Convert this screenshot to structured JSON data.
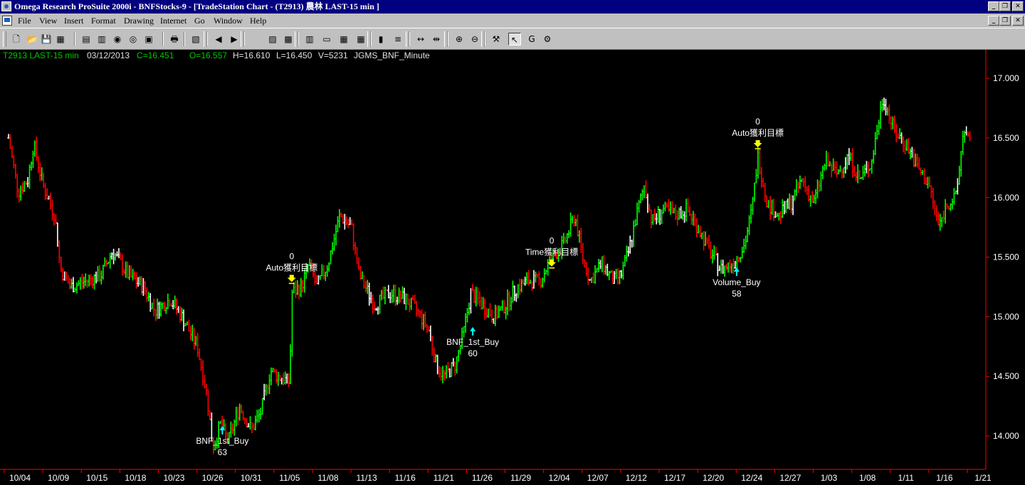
{
  "window": {
    "title": "Omega Research ProSuite 2000i - BNFStocks-9 - [TradeStation Chart - (T2913) 農林 LAST-15 min ]"
  },
  "menu": [
    "File",
    "View",
    "Insert",
    "Format",
    "Drawing",
    "Internet",
    "Go",
    "Window",
    "Help"
  ],
  "toolbar": {
    "buttons": [
      {
        "name": "new-icon",
        "glyph": "🗋"
      },
      {
        "name": "open-icon",
        "glyph": "📂"
      },
      {
        "name": "save-icon",
        "glyph": "💾"
      },
      {
        "name": "save-all-icon",
        "glyph": "▦"
      },
      {
        "name": "print-preview-icon",
        "glyph": "▤"
      },
      {
        "name": "chart-window-icon",
        "glyph": "▥"
      },
      {
        "name": "radar-screen-icon",
        "glyph": "◉"
      },
      {
        "name": "option-station-icon",
        "glyph": "◎"
      },
      {
        "name": "symbol-icon",
        "glyph": "▣"
      },
      {
        "name": "print-icon",
        "glyph": "🖶"
      },
      {
        "name": "format-window-icon",
        "glyph": "▧"
      },
      {
        "name": "scroll-left-icon",
        "glyph": "◀"
      },
      {
        "name": "scroll-right-icon",
        "glyph": "▶"
      },
      {
        "name": "insert-indicator-icon",
        "glyph": "▨"
      },
      {
        "name": "insert-strategy-icon",
        "glyph": "▩"
      },
      {
        "name": "data-window-icon",
        "glyph": "▥"
      },
      {
        "name": "insert-window-icon",
        "glyph": "▭"
      },
      {
        "name": "grid-icon",
        "glyph": "▦"
      },
      {
        "name": "table-icon",
        "glyph": "▦"
      },
      {
        "name": "bar-chart-icon",
        "glyph": "▮"
      },
      {
        "name": "format-bars-icon",
        "glyph": "≡"
      },
      {
        "name": "compress-bars-icon",
        "glyph": "↔"
      },
      {
        "name": "expand-bars-icon",
        "glyph": "⇹"
      },
      {
        "name": "zoom-in-icon",
        "glyph": "⊕"
      },
      {
        "name": "zoom-out-icon",
        "glyph": "⊖"
      },
      {
        "name": "tools-icon",
        "glyph": "⚒"
      },
      {
        "name": "pointer-icon",
        "glyph": "↖"
      },
      {
        "name": "global-icon",
        "glyph": "G"
      },
      {
        "name": "easylanguage-icon",
        "glyph": "⚙"
      }
    ]
  },
  "status": {
    "symbol": "T2913 LAST-15 min",
    "date": "03/12/2013",
    "close": "C=16.451",
    "open": "O=16.557",
    "high": "H=16.610",
    "low": "L=16.450",
    "volume": "V=5231",
    "strategy": "JGMS_BNF_Minute"
  },
  "colors": {
    "up": "#00ff00",
    "down": "#ff0000",
    "doji": "#ffffff",
    "buy_arrow": "#00ffff",
    "exit_arrow": "#ffff00",
    "axis": "#ff0000",
    "text": "#ffffff"
  },
  "chart_data": {
    "type": "ohlc",
    "ylim": [
      13.72,
      17.12
    ],
    "y_ticks": [
      14.0,
      14.5,
      15.0,
      15.5,
      16.0,
      16.5,
      17.0
    ],
    "y_tick_labels": [
      "14.000",
      "14.500",
      "15.000",
      "15.500",
      "16.000",
      "16.500",
      "17.000"
    ],
    "x_tick_labels": [
      "10/04",
      "10/09",
      "10/15",
      "10/18",
      "10/23",
      "10/26",
      "10/31",
      "11/05",
      "11/08",
      "11/13",
      "11/16",
      "11/21",
      "11/26",
      "11/29",
      "12/04",
      "12/07",
      "12/12",
      "12/17",
      "12/20",
      "12/24",
      "12/27",
      "1/03",
      "1/08",
      "1/11",
      "1/16",
      "1/21"
    ],
    "price_path": [
      {
        "d": 0,
        "p": 16.5
      },
      {
        "d": 0.25,
        "p": 16.05
      },
      {
        "d": 0.5,
        "p": 16.15
      },
      {
        "d": 0.65,
        "p": 16.45
      },
      {
        "d": 0.9,
        "p": 16.1
      },
      {
        "d": 1.2,
        "p": 15.85
      },
      {
        "d": 1.35,
        "p": 15.4
      },
      {
        "d": 1.6,
        "p": 15.25
      },
      {
        "d": 2.0,
        "p": 15.3
      },
      {
        "d": 2.4,
        "p": 15.35
      },
      {
        "d": 2.7,
        "p": 15.55
      },
      {
        "d": 3.1,
        "p": 15.35
      },
      {
        "d": 3.5,
        "p": 15.25
      },
      {
        "d": 3.8,
        "p": 15.05
      },
      {
        "d": 4.2,
        "p": 15.15
      },
      {
        "d": 4.5,
        "p": 15.0
      },
      {
        "d": 4.9,
        "p": 14.75
      },
      {
        "d": 5.15,
        "p": 14.35
      },
      {
        "d": 5.3,
        "p": 13.9
      },
      {
        "d": 5.5,
        "p": 14.1
      },
      {
        "d": 5.7,
        "p": 13.95
      },
      {
        "d": 6.0,
        "p": 14.25
      },
      {
        "d": 6.3,
        "p": 14.05
      },
      {
        "d": 6.55,
        "p": 14.2
      },
      {
        "d": 6.8,
        "p": 14.55
      },
      {
        "d": 7.0,
        "p": 14.5
      },
      {
        "d": 7.3,
        "p": 14.45
      },
      {
        "d": 7.35,
        "p": 15.2
      },
      {
        "d": 7.6,
        "p": 15.25
      },
      {
        "d": 7.8,
        "p": 15.45
      },
      {
        "d": 8.0,
        "p": 15.25
      },
      {
        "d": 8.3,
        "p": 15.45
      },
      {
        "d": 8.6,
        "p": 15.85
      },
      {
        "d": 8.9,
        "p": 15.75
      },
      {
        "d": 9.1,
        "p": 15.35
      },
      {
        "d": 9.5,
        "p": 15.1
      },
      {
        "d": 9.9,
        "p": 15.2
      },
      {
        "d": 10.3,
        "p": 15.15
      },
      {
        "d": 10.6,
        "p": 15.05
      },
      {
        "d": 10.9,
        "p": 14.9
      },
      {
        "d": 11.1,
        "p": 14.6
      },
      {
        "d": 11.3,
        "p": 14.5
      },
      {
        "d": 11.6,
        "p": 14.6
      },
      {
        "d": 11.8,
        "p": 14.85
      },
      {
        "d": 12.0,
        "p": 15.2
      },
      {
        "d": 12.3,
        "p": 15.1
      },
      {
        "d": 12.6,
        "p": 15.0
      },
      {
        "d": 12.9,
        "p": 15.1
      },
      {
        "d": 13.2,
        "p": 15.25
      },
      {
        "d": 13.5,
        "p": 15.3
      },
      {
        "d": 13.8,
        "p": 15.3
      },
      {
        "d": 14.1,
        "p": 15.5
      },
      {
        "d": 14.4,
        "p": 15.6
      },
      {
        "d": 14.7,
        "p": 15.85
      },
      {
        "d": 14.9,
        "p": 15.5
      },
      {
        "d": 15.1,
        "p": 15.3
      },
      {
        "d": 15.4,
        "p": 15.45
      },
      {
        "d": 15.7,
        "p": 15.3
      },
      {
        "d": 15.9,
        "p": 15.35
      },
      {
        "d": 16.1,
        "p": 15.55
      },
      {
        "d": 16.3,
        "p": 15.85
      },
      {
        "d": 16.5,
        "p": 16.1
      },
      {
        "d": 16.7,
        "p": 15.8
      },
      {
        "d": 17.0,
        "p": 15.9
      },
      {
        "d": 17.3,
        "p": 15.85
      },
      {
        "d": 17.6,
        "p": 15.9
      },
      {
        "d": 17.9,
        "p": 15.75
      },
      {
        "d": 18.2,
        "p": 15.55
      },
      {
        "d": 18.5,
        "p": 15.4
      },
      {
        "d": 18.8,
        "p": 15.45
      },
      {
        "d": 19.1,
        "p": 15.6
      },
      {
        "d": 19.3,
        "p": 15.9
      },
      {
        "d": 19.45,
        "p": 16.35
      },
      {
        "d": 19.7,
        "p": 15.95
      },
      {
        "d": 20.0,
        "p": 15.85
      },
      {
        "d": 20.3,
        "p": 15.95
      },
      {
        "d": 20.6,
        "p": 16.15
      },
      {
        "d": 20.9,
        "p": 15.95
      },
      {
        "d": 21.2,
        "p": 16.3
      },
      {
        "d": 21.5,
        "p": 16.2
      },
      {
        "d": 21.8,
        "p": 16.35
      },
      {
        "d": 22.1,
        "p": 16.15
      },
      {
        "d": 22.4,
        "p": 16.3
      },
      {
        "d": 22.7,
        "p": 16.85
      },
      {
        "d": 23.0,
        "p": 16.55
      },
      {
        "d": 23.3,
        "p": 16.45
      },
      {
        "d": 23.6,
        "p": 16.25
      },
      {
        "d": 23.9,
        "p": 16.1
      },
      {
        "d": 24.15,
        "p": 15.75
      },
      {
        "d": 24.35,
        "p": 15.95
      },
      {
        "d": 24.6,
        "p": 16.0
      },
      {
        "d": 24.8,
        "p": 16.6
      },
      {
        "d": 25.0,
        "p": 16.4
      }
    ],
    "signals": [
      {
        "d": 5.55,
        "p": 14.12,
        "kind": "buy",
        "label": "BNF_1st_Buy",
        "value": "63"
      },
      {
        "d": 7.35,
        "p": 15.22,
        "kind": "exit",
        "label": "Auto獲利目標",
        "value": "0"
      },
      {
        "d": 12.05,
        "p": 14.95,
        "kind": "buy",
        "label": "BNF_1st_Buy",
        "value": "60"
      },
      {
        "d": 14.1,
        "p": 15.35,
        "kind": "exit",
        "label": "Time獲利目標",
        "value": "0"
      },
      {
        "d": 18.9,
        "p": 15.45,
        "kind": "buy",
        "label": "Volume_Buy",
        "value": "58"
      },
      {
        "d": 19.45,
        "p": 16.35,
        "kind": "exit",
        "label": "Auto獲利目標",
        "value": "0"
      }
    ]
  }
}
